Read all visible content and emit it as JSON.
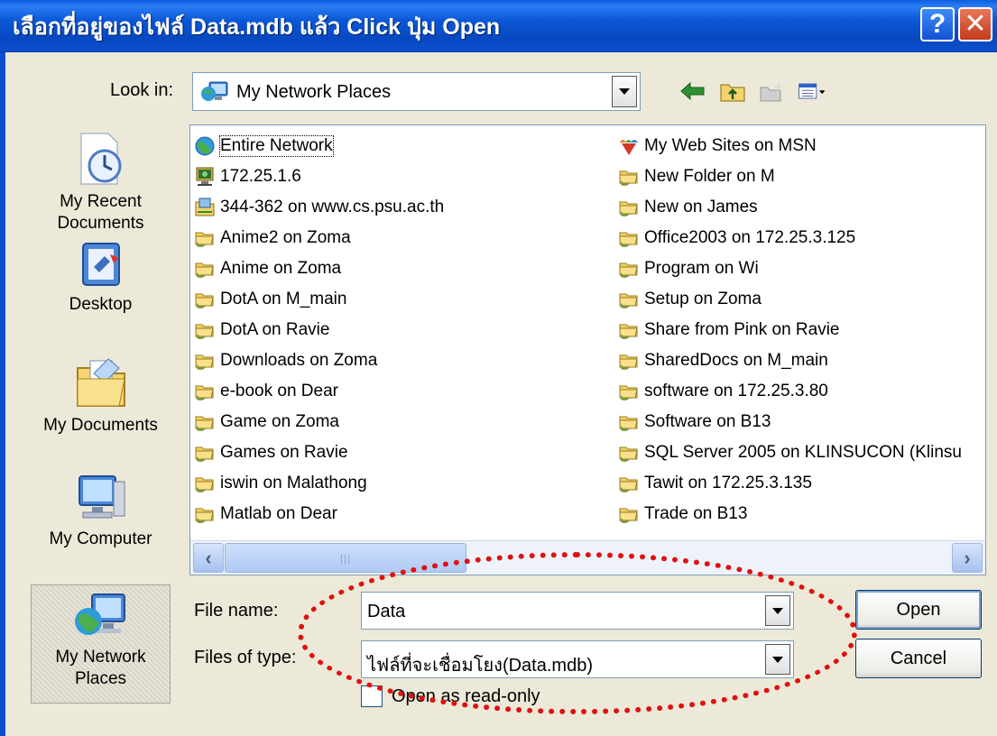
{
  "window": {
    "title": "เลือกที่อยู่ของไฟล์ Data.mdb แล้ว Click ปุ่ม Open",
    "help_glyph": "?",
    "close_glyph": "✕"
  },
  "lookin": {
    "label": "Look in:",
    "value": "My Network Places",
    "icon": "network-places-icon"
  },
  "toolbar": {
    "icons": [
      "back-arrow-icon",
      "up-folder-icon",
      "new-folder-icon",
      "view-menu-icon"
    ]
  },
  "places": [
    {
      "label": "My Recent Documents",
      "icon": "recent-documents-icon"
    },
    {
      "label": "Desktop",
      "icon": "desktop-icon"
    },
    {
      "label": "My Documents",
      "icon": "my-documents-icon"
    },
    {
      "label": "My Computer",
      "icon": "my-computer-icon"
    },
    {
      "label": "My Network Places",
      "icon": "network-places-icon",
      "selected": true
    }
  ],
  "files": {
    "col1": [
      {
        "name": "Entire Network",
        "icon": "globe"
      },
      {
        "name": "172.25.1.6",
        "icon": "computer"
      },
      {
        "name": "344-362 on www.cs.psu.ac.th",
        "icon": "ftp"
      },
      {
        "name": "Anime2 on Zoma",
        "icon": "share"
      },
      {
        "name": "Anime on Zoma",
        "icon": "share"
      },
      {
        "name": "DotA on M_main",
        "icon": "share"
      },
      {
        "name": "DotA on Ravie",
        "icon": "share"
      },
      {
        "name": "Downloads on Zoma",
        "icon": "share"
      },
      {
        "name": "e-book on Dear",
        "icon": "share"
      },
      {
        "name": "Game on Zoma",
        "icon": "share"
      },
      {
        "name": "Games on Ravie",
        "icon": "share"
      },
      {
        "name": "iswin on Malathong",
        "icon": "share"
      },
      {
        "name": "Matlab on Dear",
        "icon": "share"
      }
    ],
    "col2": [
      {
        "name": "My Web Sites on MSN",
        "icon": "msn"
      },
      {
        "name": "New Folder on M",
        "icon": "share"
      },
      {
        "name": "New on James",
        "icon": "share"
      },
      {
        "name": "Office2003 on 172.25.3.125",
        "icon": "share"
      },
      {
        "name": "Program on Wi",
        "icon": "share"
      },
      {
        "name": "Setup on Zoma",
        "icon": "share"
      },
      {
        "name": "Share from Pink on Ravie",
        "icon": "share"
      },
      {
        "name": "SharedDocs on M_main",
        "icon": "share"
      },
      {
        "name": "software on 172.25.3.80",
        "icon": "share"
      },
      {
        "name": "Software on B13",
        "icon": "share"
      },
      {
        "name": "SQL Server 2005 on KLINSUCON (Klinsu",
        "icon": "share"
      },
      {
        "name": "Tawit on 172.25.3.135",
        "icon": "share"
      },
      {
        "name": "Trade on B13",
        "icon": "share"
      }
    ]
  },
  "filename": {
    "label": "File name:",
    "value": "Data"
  },
  "filetype": {
    "label": "Files of type:",
    "value": "ไฟล์ที่จะเชื่อมโยง(Data.mdb)"
  },
  "buttons": {
    "open": "Open",
    "cancel": "Cancel"
  },
  "readonly": {
    "label": "Open as read-only",
    "checked": false
  },
  "colors": {
    "annotation": "#e01010",
    "titlebar": "#0a57d6"
  }
}
